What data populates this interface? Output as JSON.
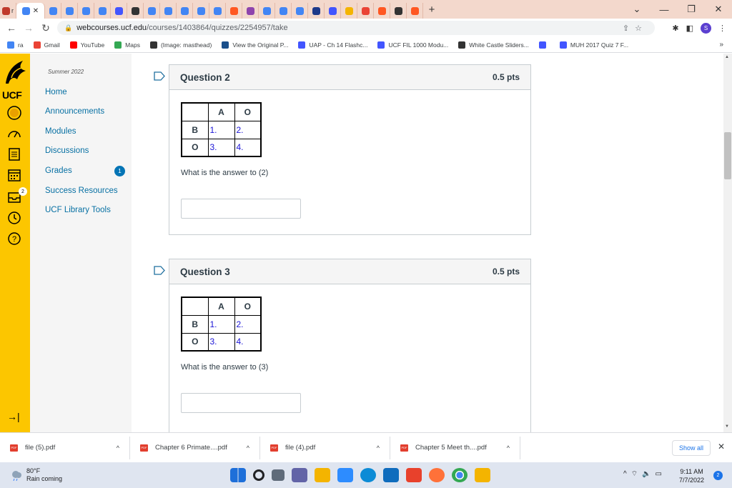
{
  "browser": {
    "tabs": [
      {
        "label": "r",
        "color": "#c0392b"
      },
      {
        "label": "",
        "color": "#4285f4",
        "active": true
      },
      {
        "label": "",
        "color": "#4285f4"
      },
      {
        "label": "",
        "color": "#4285f4"
      },
      {
        "label": "",
        "color": "#4285f4"
      },
      {
        "label": "",
        "color": "#4285f4"
      },
      {
        "label": "",
        "color": "#4255ff"
      },
      {
        "label": "",
        "color": "#333333"
      },
      {
        "label": "",
        "color": "#4285f4"
      },
      {
        "label": "",
        "color": "#4285f4"
      },
      {
        "label": "",
        "color": "#4285f4"
      },
      {
        "label": "",
        "color": "#4285f4"
      },
      {
        "label": "",
        "color": "#4285f4"
      },
      {
        "label": "",
        "color": "#ff5722"
      },
      {
        "label": "",
        "color": "#8e44ad"
      },
      {
        "label": "",
        "color": "#4285f4"
      },
      {
        "label": "",
        "color": "#4285f4"
      },
      {
        "label": "",
        "color": "#4285f4"
      },
      {
        "label": "",
        "color": "#1e3a8a"
      },
      {
        "label": "",
        "color": "#4255ff"
      },
      {
        "label": "",
        "color": "#f4b400"
      },
      {
        "label": "",
        "color": "#ea4335"
      },
      {
        "label": "",
        "color": "#ff5722"
      },
      {
        "label": "",
        "color": "#333333"
      },
      {
        "label": "",
        "color": "#ff5722"
      }
    ],
    "new_tab": "+",
    "url_host": "webcourses.ucf.edu",
    "url_path": "/courses/1403864/quizzes/2254957/take",
    "profile_letter": "S",
    "bookmarks": [
      {
        "label": "ra",
        "color": "#4285f4"
      },
      {
        "label": "Gmail",
        "color": "#ea4335"
      },
      {
        "label": "YouTube",
        "color": "#ff0000"
      },
      {
        "label": "Maps",
        "color": "#34a853"
      },
      {
        "label": "(Image: masthead)",
        "color": "#333333"
      },
      {
        "label": "View the Original P...",
        "color": "#1a4f8b"
      },
      {
        "label": "UAP - Ch 14 Flashc...",
        "color": "#4255ff"
      },
      {
        "label": "UCF FIL 1000 Modu...",
        "color": "#4255ff"
      },
      {
        "label": "White Castle Sliders...",
        "color": "#333333"
      },
      {
        "label": "",
        "color": "#4255ff"
      },
      {
        "label": "MUH 2017 Quiz 7 F...",
        "color": "#4255ff"
      }
    ],
    "bookmarks_more": "»"
  },
  "global_nav": {
    "logo_text": "UCF",
    "inbox_badge": "2"
  },
  "course_nav": {
    "term": "Summer 2022",
    "items": [
      {
        "label": "Home"
      },
      {
        "label": "Announcements"
      },
      {
        "label": "Modules"
      },
      {
        "label": "Discussions"
      },
      {
        "label": "Grades"
      },
      {
        "label": "Success Resources"
      },
      {
        "label": "UCF Library Tools"
      }
    ],
    "grades_badge": "1"
  },
  "questions": [
    {
      "title": "Question 2",
      "points": "0.5 pts",
      "table": {
        "col_headers": [
          "A",
          "O"
        ],
        "rows": [
          {
            "header": "B",
            "cells": [
              "1.",
              "2."
            ]
          },
          {
            "header": "O",
            "cells": [
              "3.",
              "4."
            ]
          }
        ]
      },
      "prompt": "What is the answer to (2)",
      "answer": ""
    },
    {
      "title": "Question 3",
      "points": "0.5 pts",
      "table": {
        "col_headers": [
          "A",
          "O"
        ],
        "rows": [
          {
            "header": "B",
            "cells": [
              "1.",
              "2."
            ]
          },
          {
            "header": "O",
            "cells": [
              "3.",
              "4."
            ]
          }
        ]
      },
      "prompt": "What is the answer to (3)",
      "answer": ""
    }
  ],
  "downloads": {
    "items": [
      {
        "name": "file (5).pdf"
      },
      {
        "name": "Chapter 6 Primate....pdf"
      },
      {
        "name": "file (4).pdf"
      },
      {
        "name": "Chapter 5 Meet th....pdf"
      }
    ],
    "show_all": "Show all"
  },
  "taskbar": {
    "temperature": "80°F",
    "weather_text": "Rain coming",
    "time": "9:11 AM",
    "date": "7/7/2022",
    "notification_count": "2"
  }
}
